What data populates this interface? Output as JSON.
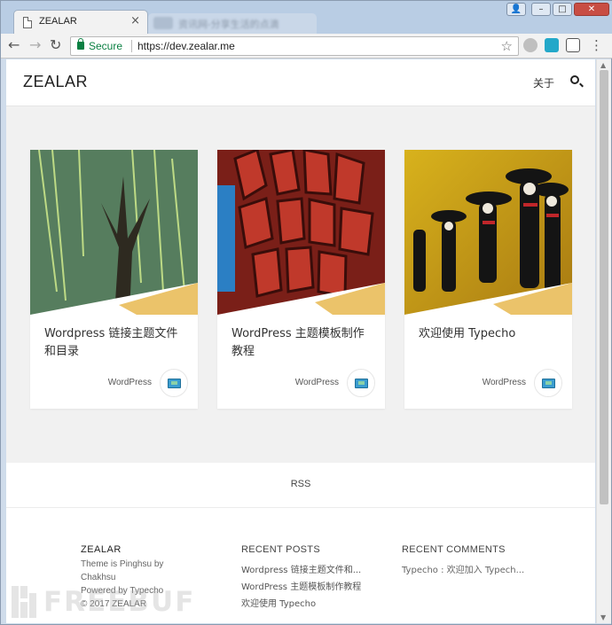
{
  "browser": {
    "tab_title": "ZEALAR",
    "tab_close": "×",
    "inactive_tab_title": "资讯网-分享生活的点滴",
    "secure_label": "Secure",
    "url": "https://dev.zealar.me",
    "back": "←",
    "forward": "→",
    "reload": "↻",
    "star": "☆",
    "menu": "⋮",
    "win_user": "👤",
    "win_min": "–",
    "win_max": "□",
    "win_close": "✕"
  },
  "site": {
    "brand": "ZEALAR",
    "nav_about": "关于",
    "search_icon": "search-icon"
  },
  "posts": [
    {
      "title": "Wordpress 链接主题文件和目录",
      "category": "WordPress",
      "icon": "image-post-icon"
    },
    {
      "title": "WordPress 主题模板制作教程",
      "category": "WordPress",
      "icon": "image-post-icon"
    },
    {
      "title": "欢迎使用 Typecho",
      "category": "WordPress",
      "icon": "image-post-icon"
    }
  ],
  "rss": "RSS",
  "footer": {
    "brand": "ZEALAR",
    "theme_line1": "Theme is Pinghsu by",
    "theme_line2": "Chakhsu",
    "powered": "Powered by Typecho",
    "copyright": "© 2017 ZEALAR",
    "recent_posts_title": "RECENT POSTS",
    "recent_posts": [
      "Wordpress 链接主题文件和...",
      "WordPress 主题模板制作教程",
      "欢迎使用 Typecho"
    ],
    "recent_comments_title": "RECENT COMMENTS",
    "recent_comments": [
      "Typecho : 欢迎加入 Typech..."
    ]
  },
  "watermark": "FREEBUF",
  "colors": {
    "accent_bar": "#e8b850",
    "secure_green": "#0b8043",
    "page_bg": "#f1f1f1"
  }
}
